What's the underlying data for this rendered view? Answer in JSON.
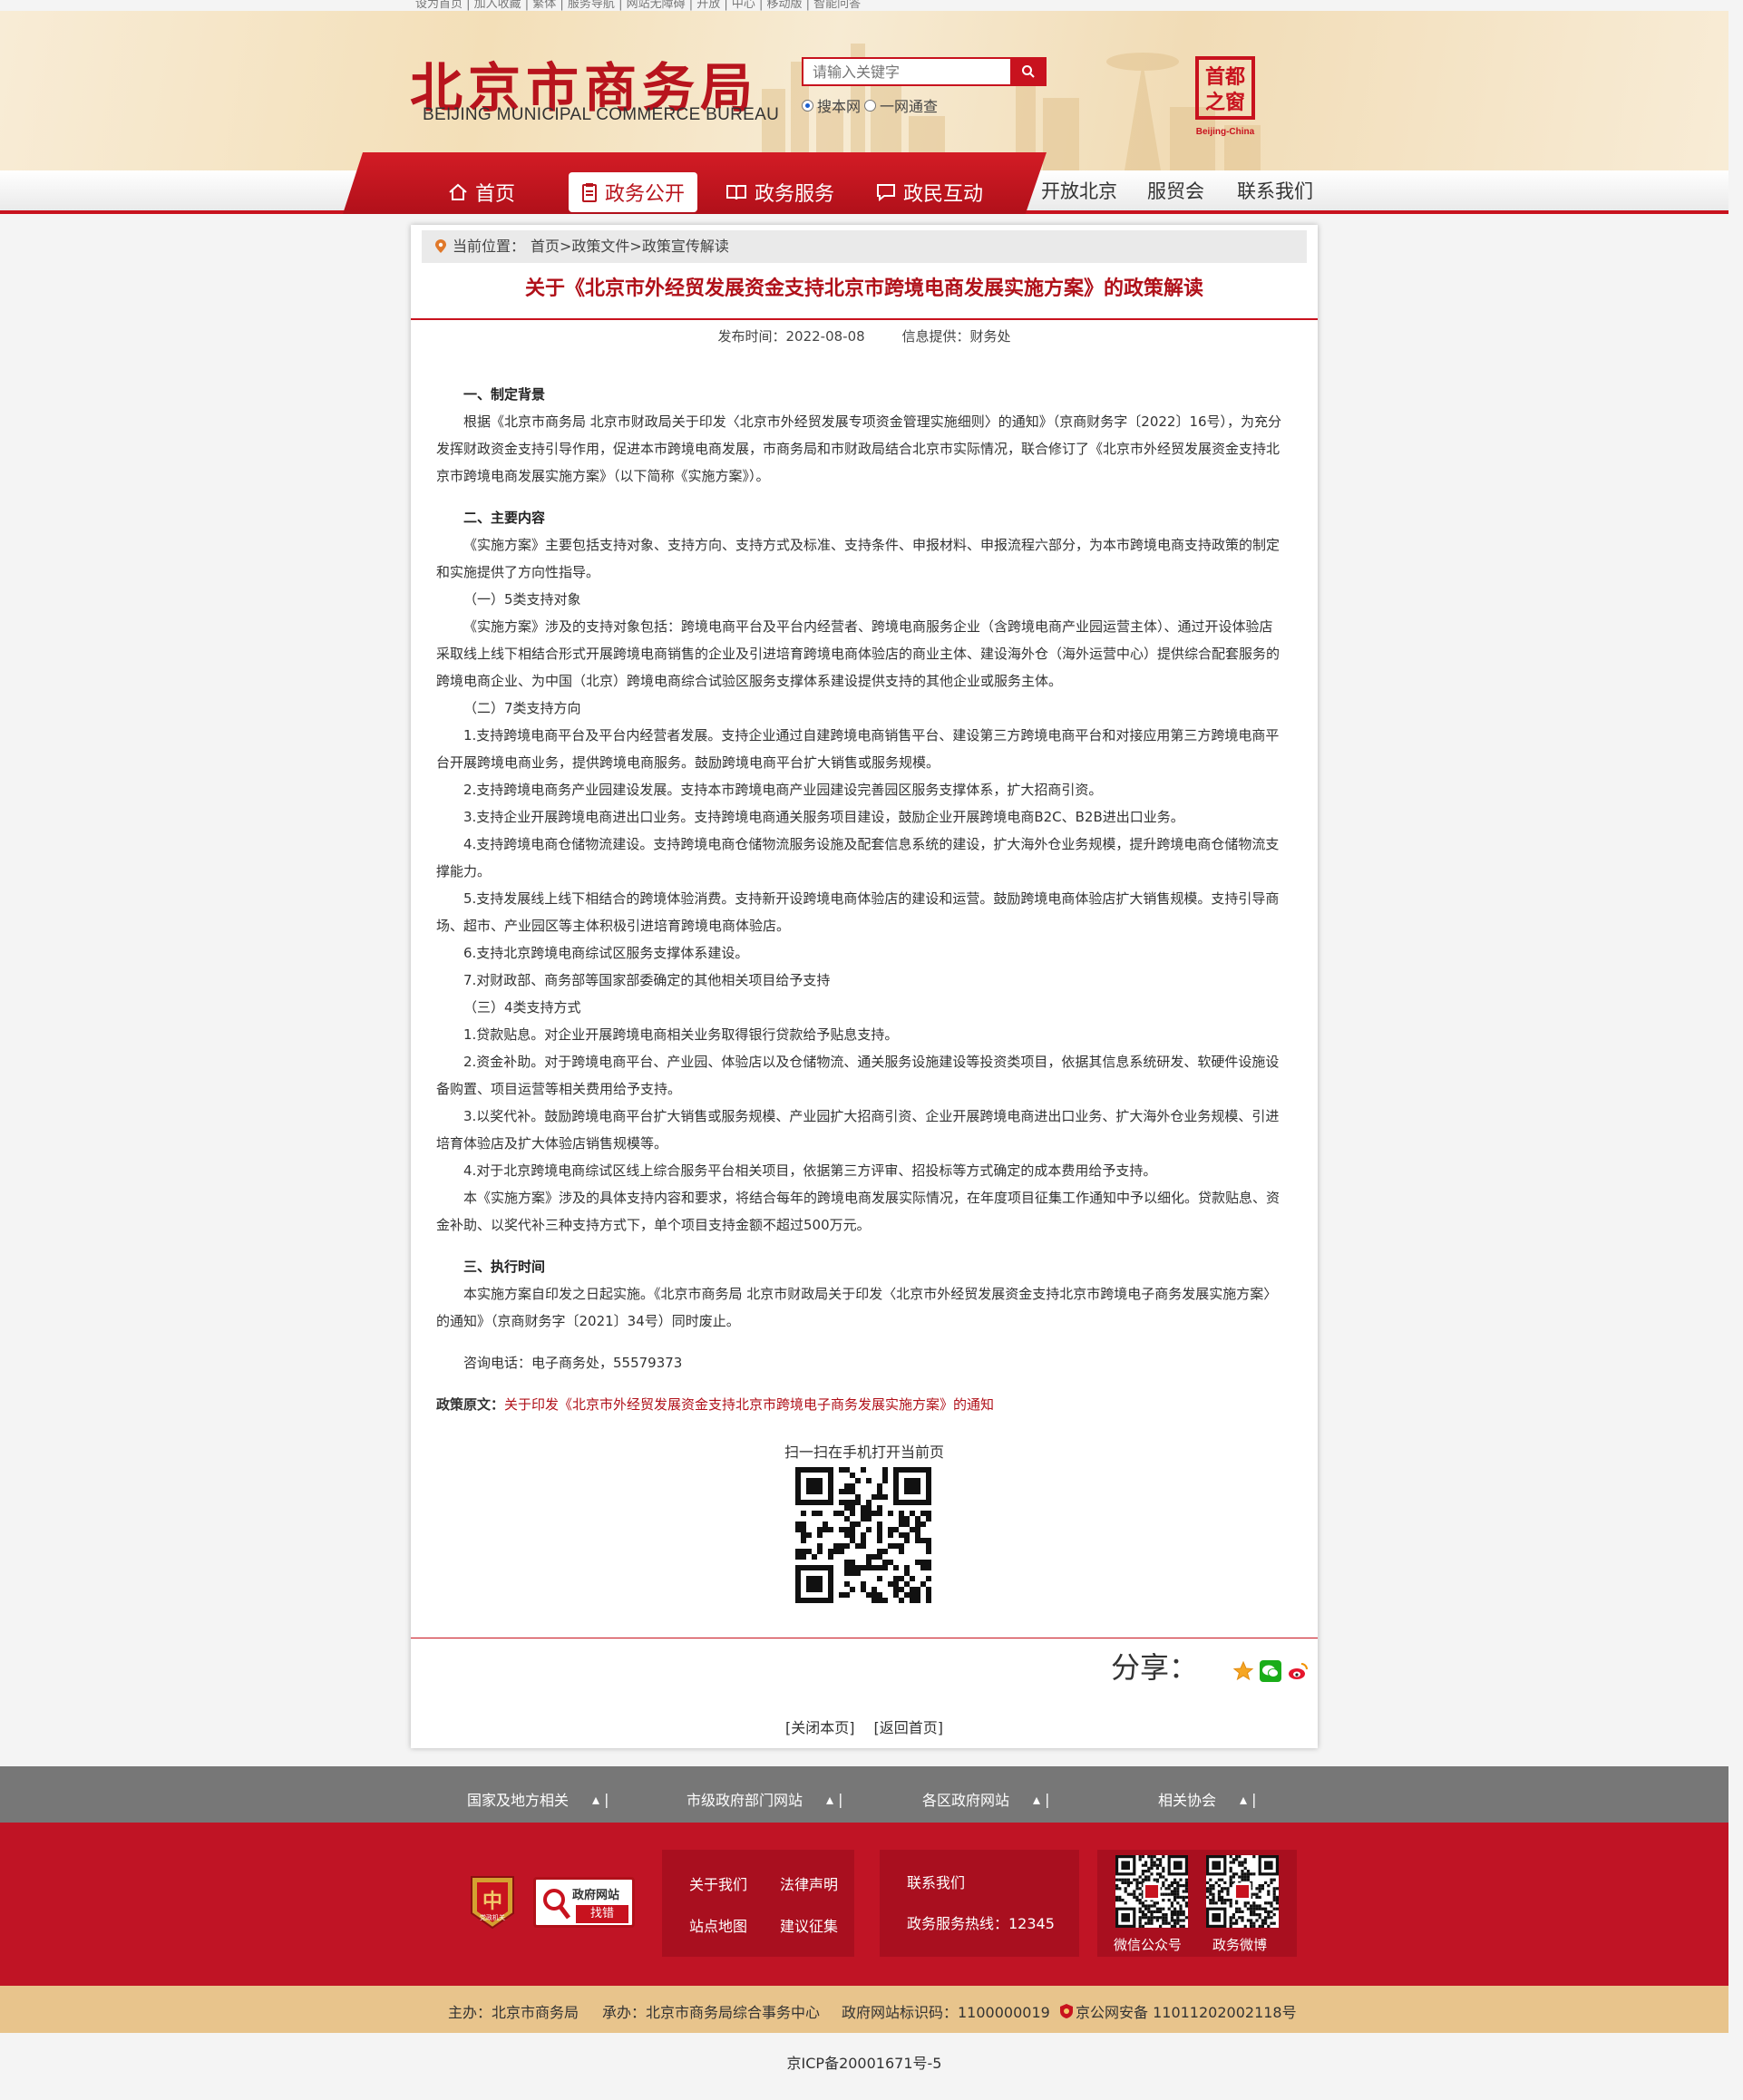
{
  "top_links": "设为首页 | 加入收藏 | 繁体 | 服务导航 | 网站无障碍 | 开放 | 中心 | 移动版 | 智能问答",
  "site": {
    "name_cn": "北京市商务局",
    "name_en": "BEIJING MUNICIPAL COMMERCE BUREAU",
    "seal_text": "首都之窗",
    "seal_en": "Beijing-China"
  },
  "search": {
    "placeholder": "请输入关键字",
    "scope_site": "搜本网",
    "scope_all": "一网通查"
  },
  "nav": {
    "items": [
      "首页",
      "政务公开",
      "政务服务",
      "政民互动"
    ],
    "plain": [
      "开放北京",
      "服贸会",
      "联系我们"
    ]
  },
  "breadcrumb": {
    "prefix": "当前位置：",
    "path": "首页>政策文件>政策宣传解读"
  },
  "article": {
    "title": "关于《北京市外经贸发展资金支持北京市跨境电商发展实施方案》的政策解读",
    "date_label": "发布时间：2022-08-08",
    "source_label": "信息提供：财务处",
    "paragraphs": [
      {
        "h": true,
        "text": "一、制定背景"
      },
      {
        "text": "根据《北京市商务局 北京市财政局关于印发〈北京市外经贸发展专项资金管理实施细则〉的通知》（京商财务字〔2022〕16号），为充分发挥财政资金支持引导作用，促进本市跨境电商发展，市商务局和市财政局结合北京市实际情况，联合修订了《北京市外经贸发展资金支持北京市跨境电商发展实施方案》（以下简称《实施方案》）。"
      },
      {
        "h": true,
        "text": "二、主要内容"
      },
      {
        "text": "《实施方案》主要包括支持对象、支持方向、支持方式及标准、支持条件、申报材料、申报流程六部分，为本市跨境电商支持政策的制定和实施提供了方向性指导。"
      },
      {
        "text": "（一）5类支持对象"
      },
      {
        "text": "《实施方案》涉及的支持对象包括：跨境电商平台及平台内经营者、跨境电商服务企业（含跨境电商产业园运营主体）、通过开设体验店采取线上线下相结合形式开展跨境电商销售的企业及引进培育跨境电商体验店的商业主体、建设海外仓（海外运营中心）提供综合配套服务的跨境电商企业、为中国（北京）跨境电商综合试验区服务支撑体系建设提供支持的其他企业或服务主体。"
      },
      {
        "text": "（二）7类支持方向"
      },
      {
        "text": "1.支持跨境电商平台及平台内经营者发展。支持企业通过自建跨境电商销售平台、建设第三方跨境电商平台和对接应用第三方跨境电商平台开展跨境电商业务，提供跨境电商服务。鼓励跨境电商平台扩大销售或服务规模。"
      },
      {
        "text": "2.支持跨境电商务产业园建设发展。支持本市跨境电商产业园建设完善园区服务支撑体系，扩大招商引资。"
      },
      {
        "text": "3.支持企业开展跨境电商进出口业务。支持跨境电商通关服务项目建设，鼓励企业开展跨境电商B2C、B2B进出口业务。"
      },
      {
        "text": "4.支持跨境电商仓储物流建设。支持跨境电商仓储物流服务设施及配套信息系统的建设，扩大海外仓业务规模，提升跨境电商仓储物流支撑能力。"
      },
      {
        "text": "5.支持发展线上线下相结合的跨境体验消费。支持新开设跨境电商体验店的建设和运营。鼓励跨境电商体验店扩大销售规模。支持引导商场、超市、产业园区等主体积极引进培育跨境电商体验店。"
      },
      {
        "text": "6.支持北京跨境电商综试区服务支撑体系建设。"
      },
      {
        "text": "7.对财政部、商务部等国家部委确定的其他相关项目给予支持"
      },
      {
        "text": "（三）4类支持方式"
      },
      {
        "text": "1.贷款贴息。对企业开展跨境电商相关业务取得银行贷款给予贴息支持。"
      },
      {
        "text": "2.资金补助。对于跨境电商平台、产业园、体验店以及仓储物流、通关服务设施建设等投资类项目，依据其信息系统研发、软硬件设施设备购置、项目运营等相关费用给予支持。"
      },
      {
        "text": "3.以奖代补。鼓励跨境电商平台扩大销售或服务规模、产业园扩大招商引资、企业开展跨境电商进出口业务、扩大海外仓业务规模、引进培育体验店及扩大体验店销售规模等。"
      },
      {
        "text": "4.对于北京跨境电商综试区线上综合服务平台相关项目，依据第三方评审、招投标等方式确定的成本费用给予支持。"
      },
      {
        "text": "本《实施方案》涉及的具体支持内容和要求，将结合每年的跨境电商发展实际情况，在年度项目征集工作通知中予以细化。贷款贴息、资金补助、以奖代补三种支持方式下，单个项目支持金额不超过500万元。"
      },
      {
        "h": true,
        "text": "三、执行时间"
      },
      {
        "text": "本实施方案自印发之日起实施。《北京市商务局 北京市财政局关于印发〈北京市外经贸发展资金支持北京市跨境电子商务发展实施方案〉的通知》（京商财务字〔2021〕34号）同时废止。"
      },
      {
        "gap": true,
        "text": "咨询电话：电子商务处，55579373"
      }
    ],
    "policy_label": "政策原文：",
    "policy_link": "关于印发《北京市外经贸发展资金支持北京市跨境电子商务发展实施方案》的通知"
  },
  "qr_label": "扫一扫在手机打开当前页",
  "share_label": "分享：",
  "bottom_links": {
    "close": "[关闭本页]",
    "home": "[返回首页]"
  },
  "footer": {
    "gray": [
      "国家及地方相关",
      "市级政府部门网站",
      "各区政府网站",
      "相关协会"
    ],
    "emblem_text": "党政机关",
    "zhaocuo_top": "政府网站",
    "zhaocuo_bottom": "找错",
    "links": [
      "关于我们",
      "法律声明",
      "站点地图",
      "建议征集"
    ],
    "contact_title": "联系我们",
    "hotline": "政务服务热线：12345",
    "qr_wechat": "微信公众号",
    "qr_weibo": "政务微博",
    "sponsor": "主办：北京市商务局",
    "undertaker": "承办：北京市商务局综合事务中心",
    "site_code": "政府网站标识码：1100000019",
    "police": "京公网安备 11011202002118号",
    "icp": "京ICP备20001671号-5"
  },
  "colors": {
    "brand_red": "#c8121e",
    "title_red": "#b01019",
    "footer_red": "#c01425",
    "footer_tan": "#e8c48c",
    "footer_gray": "#777777"
  }
}
